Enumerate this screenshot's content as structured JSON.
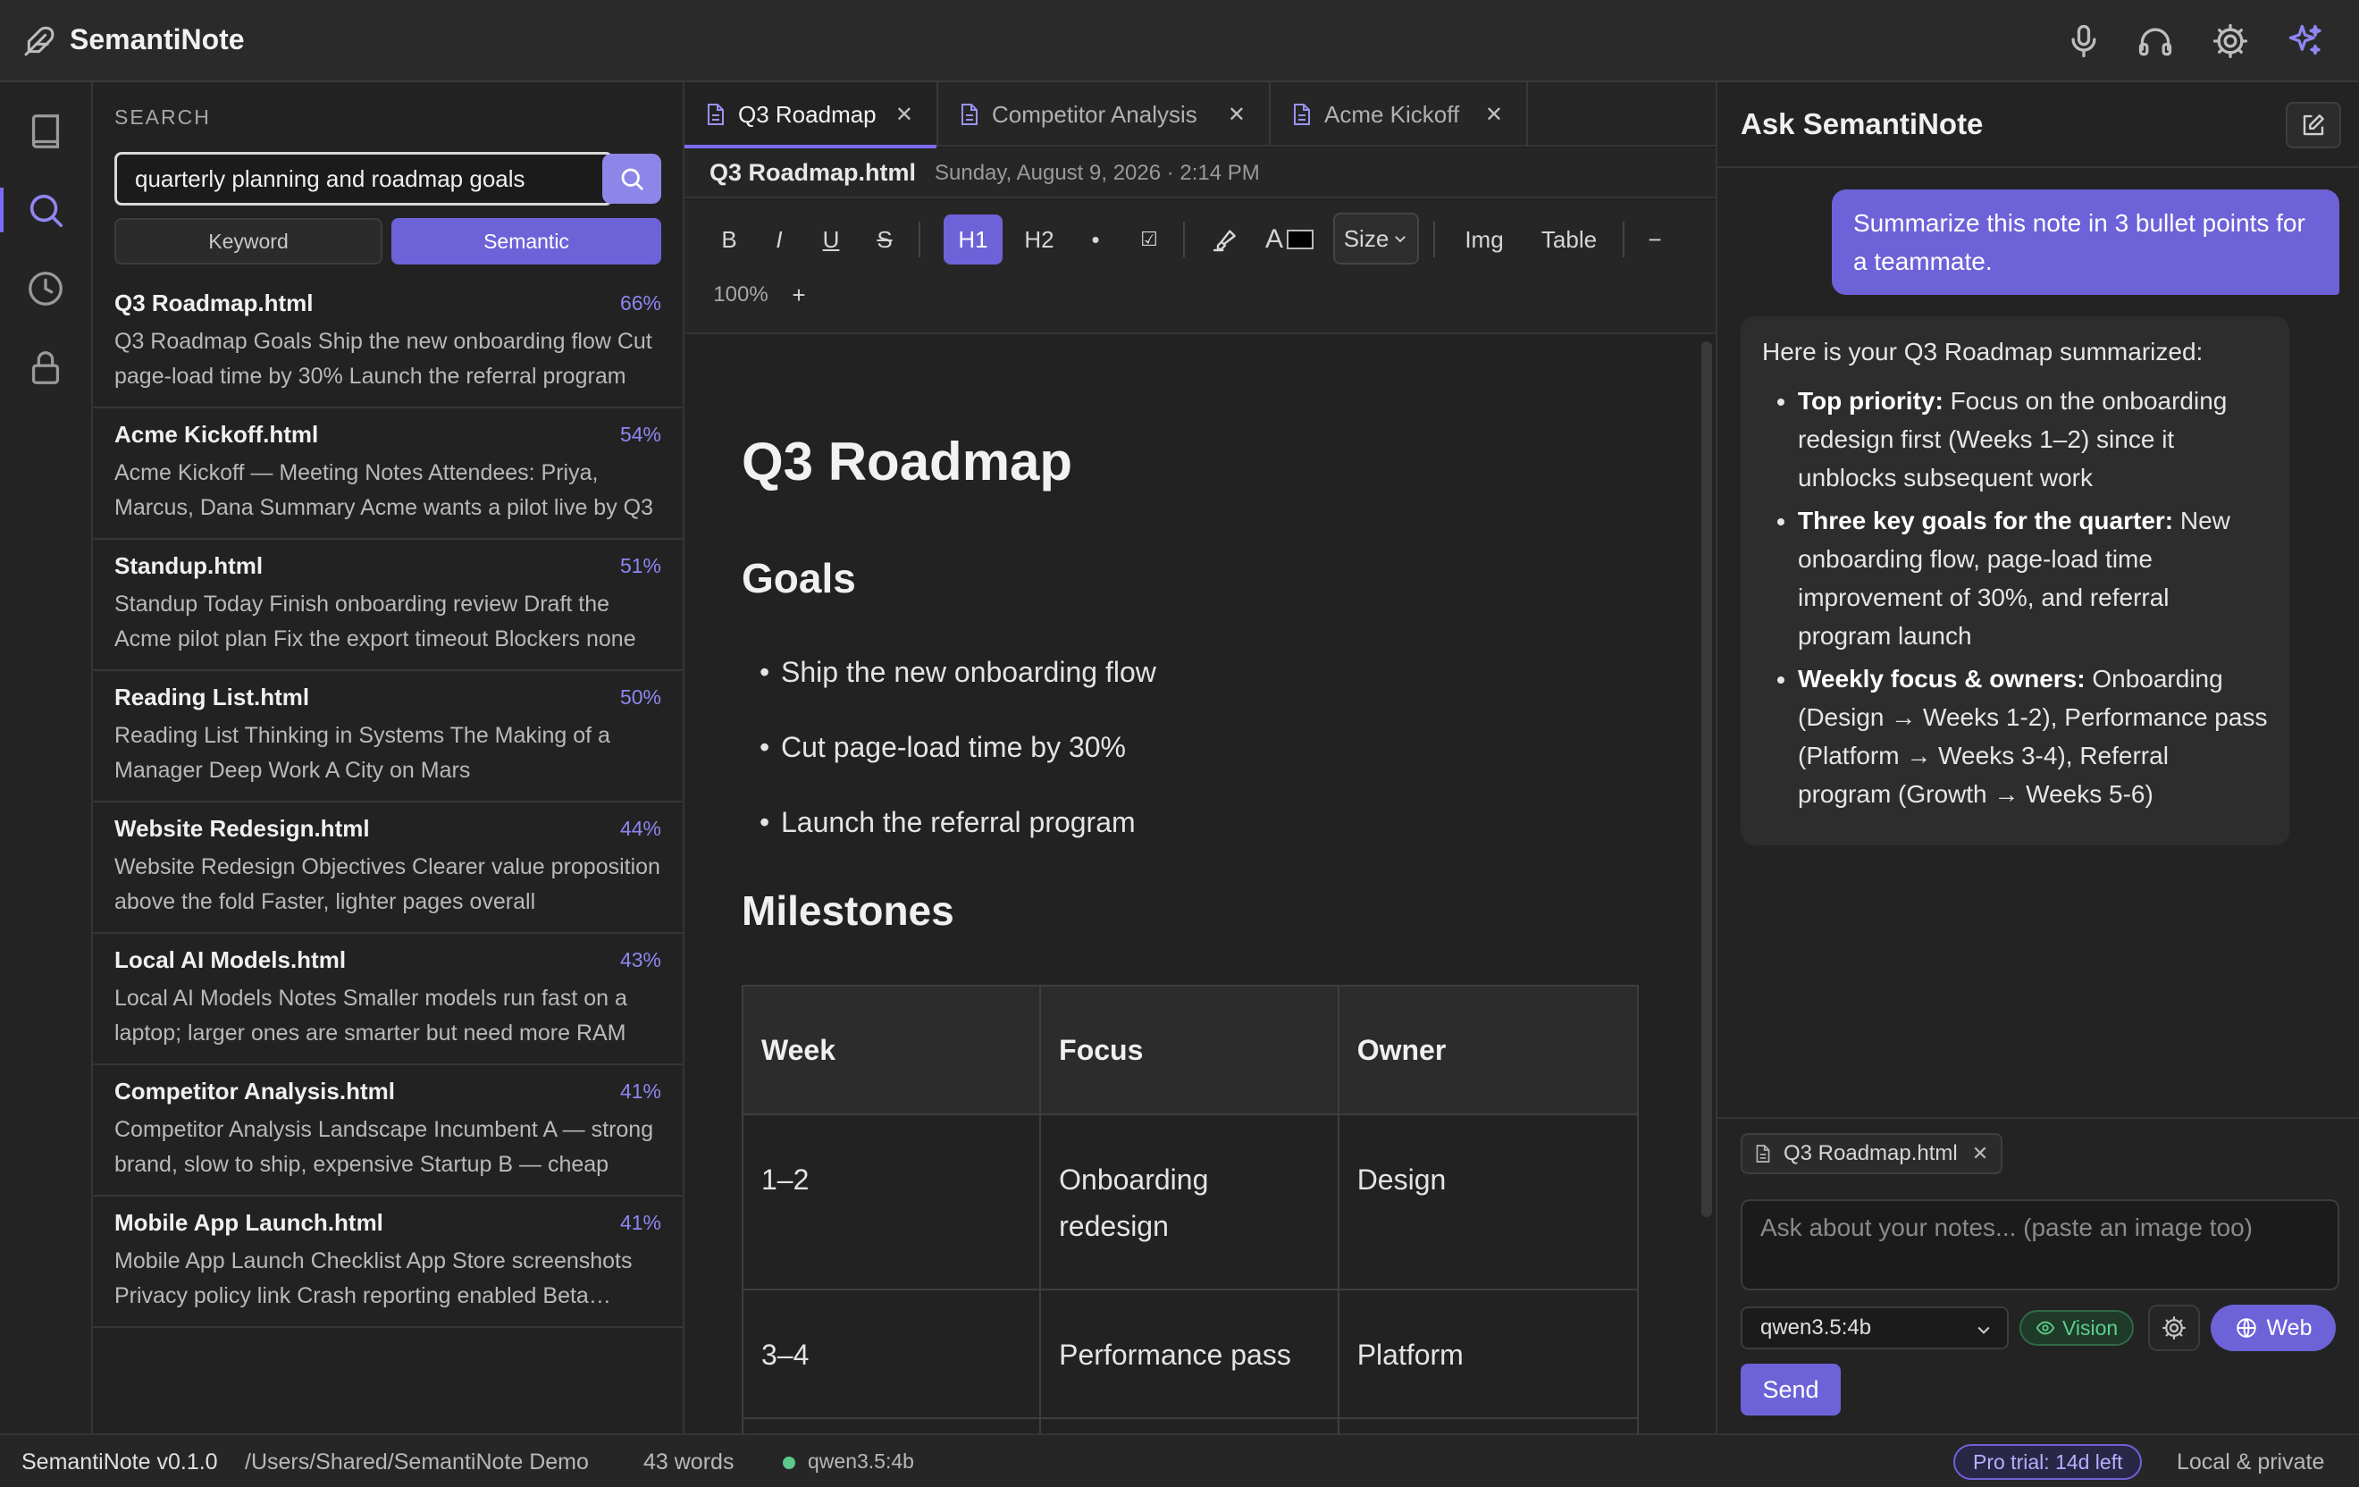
{
  "app": {
    "title": "SemantiNote",
    "top_icons": [
      "feather-logo-icon",
      "microphone-icon",
      "headphones-icon",
      "settings-gear-icon",
      "sparkle-ai-icon"
    ]
  },
  "rail": {
    "items": [
      "notebook-icon",
      "search-icon",
      "history-clock-icon",
      "lock-icon"
    ],
    "active": "search"
  },
  "search": {
    "heading": "SEARCH",
    "query": "quarterly planning and roadmap goals",
    "modes": {
      "keyword": "Keyword",
      "semantic": "Semantic",
      "active": "Semantic"
    },
    "results": [
      {
        "title": "Q3 Roadmap.html",
        "score": "66%",
        "snippet": "Q3 Roadmap Goals Ship the new onboarding flow Cut page-load time by 30% Launch the referral program"
      },
      {
        "title": "Acme Kickoff.html",
        "score": "54%",
        "snippet": "Acme Kickoff — Meeting Notes Attendees: Priya, Marcus, Dana Summary Acme wants a pilot live by Q3"
      },
      {
        "title": "Standup.html",
        "score": "51%",
        "snippet": "Standup Today Finish onboarding review Draft the Acme pilot plan Fix the export timeout Blockers none"
      },
      {
        "title": "Reading List.html",
        "score": "50%",
        "snippet": "Reading List Thinking in Systems The Making of a Manager Deep Work A City on Mars"
      },
      {
        "title": "Website Redesign.html",
        "score": "44%",
        "snippet": "Website Redesign Objectives Clearer value proposition above the fold Faster, lighter pages overall"
      },
      {
        "title": "Local AI Models.html",
        "score": "43%",
        "snippet": "Local AI Models Notes Smaller models run fast on a laptop; larger ones are smarter but need more RAM"
      },
      {
        "title": "Competitor Analysis.html",
        "score": "41%",
        "snippet": "Competitor Analysis Landscape Incumbent A — strong brand, slow to ship, expensive Startup B — cheap"
      },
      {
        "title": "Mobile App Launch.html",
        "score": "41%",
        "snippet": "Mobile App Launch Checklist App Store screenshots Privacy policy link Crash reporting enabled Beta testers"
      }
    ]
  },
  "editor": {
    "tabs": [
      {
        "label": "Q3 Roadmap",
        "active": true
      },
      {
        "label": "Competitor Analysis",
        "active": false
      },
      {
        "label": "Acme Kickoff",
        "active": false
      }
    ],
    "doc_name": "Q3 Roadmap.html",
    "doc_date": "Sunday, August 9, 2026 · 2:14 PM",
    "toolbar": {
      "bold": "B",
      "italic": "I",
      "underline": "U",
      "strike": "S",
      "h1": "H1",
      "h2": "H2",
      "bullet": "•",
      "checkbox": "☑",
      "text_color": "A",
      "size": "Size",
      "image": "Img",
      "table": "Table",
      "zoom_out": "−",
      "zoom": "100%",
      "zoom_in": "+",
      "active": "H1"
    },
    "content": {
      "title": "Q3 Roadmap",
      "goals_heading": "Goals",
      "goals": [
        "Ship the new onboarding flow",
        "Cut page-load time by 30%",
        "Launch the referral program"
      ],
      "milestones_heading": "Milestones",
      "table": {
        "headers": [
          "Week",
          "Focus",
          "Owner"
        ],
        "rows": [
          [
            "1–2",
            "Onboarding redesign",
            "Design"
          ],
          [
            "3–4",
            "Performance pass",
            "Platform"
          ]
        ]
      }
    }
  },
  "chat": {
    "title": "Ask SemantiNote",
    "user_message": "Summarize this note in 3 bullet points for a teammate.",
    "ai_intro": "Here is your Q3 Roadmap summarized:",
    "ai_points": [
      {
        "bold": "Top priority:",
        "text": " Focus on the onboarding redesign first (Weeks 1–2) since it unblocks subsequent work"
      },
      {
        "bold": "Three key goals for the quarter:",
        "text": " New onboarding flow, page-load time improvement of 30%, and referral program launch"
      },
      {
        "bold": "Weekly focus & owners:",
        "text": " Onboarding (Design → Weeks 1-2), Performance pass (Platform → Weeks 3-4), Referral program (Growth → Weeks 5-6)"
      }
    ],
    "context_chip": "Q3 Roadmap.html",
    "input_placeholder": "Ask about your notes... (paste an image too)",
    "model": "qwen3.5:4b",
    "vision_label": "Vision",
    "web_label": "Web",
    "send_label": "Send"
  },
  "status": {
    "version": "SemantiNote v0.1.0",
    "path": "/Users/Shared/SemantiNote Demo",
    "word_count": "43 words",
    "model": "qwen3.5:4b",
    "trial": "Pro trial: 14d left",
    "privacy": "Local & private"
  },
  "colors": {
    "accent": "#6e62d8",
    "background": "#1e1e1e",
    "panel": "#222222",
    "status_green": "#5cc98a"
  }
}
